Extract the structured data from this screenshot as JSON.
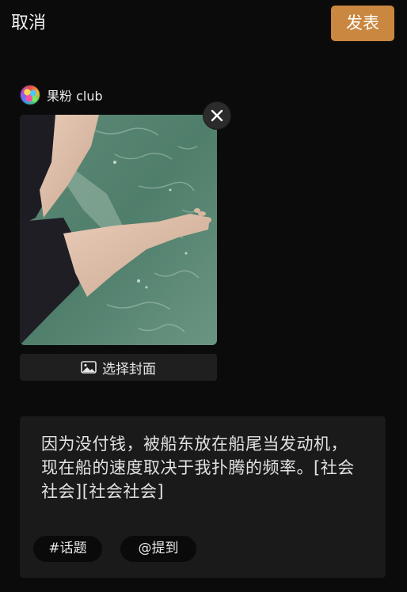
{
  "header": {
    "cancel_label": "取消",
    "publish_label": "发表",
    "publish_color": "#c9873f"
  },
  "post": {
    "author_name": "果粉 club",
    "media_icon": "close-icon",
    "cover_button_label": "选择封面",
    "cover_button_icon": "image-icon",
    "body_text": "因为没付钱，被船东放在船尾当发动机，现在船的速度取决于我扑腾的频率。[社会社会][社会社会]"
  },
  "chips": {
    "topic_label": "#话题",
    "mention_label": "@提到"
  }
}
